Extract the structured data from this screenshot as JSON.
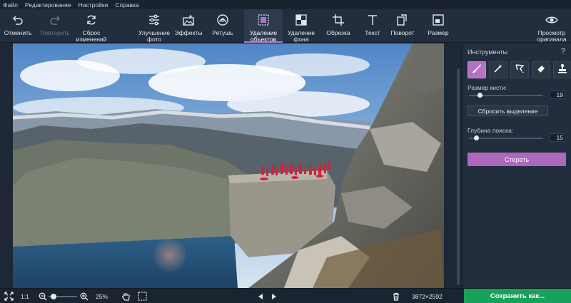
{
  "menu": [
    "Файл",
    "Редактирование",
    "Настройки",
    "Справка"
  ],
  "toolbar": {
    "undo": "Отменить",
    "redo": "Повторить",
    "reset": "Сброс\nизменений",
    "enhance": "Улучшение\nфото",
    "effects": "Эффекты",
    "retouch": "Ретушь",
    "object_removal": "Удаление\nобъектов",
    "bg_removal": "Удаление\nфона",
    "crop": "Обрезка",
    "text": "Текст",
    "rotate": "Поворот",
    "resize": "Размер",
    "preview": "Просмотр\nоригинала"
  },
  "panel": {
    "title": "Инструменты",
    "help": "?",
    "tools": [
      "brush-icon",
      "magic-wand-icon",
      "lasso-icon",
      "eraser-icon",
      "stamp-icon"
    ],
    "brush_size_label": "Размер кисти:",
    "brush_size_value": "19",
    "brush_size_fraction": 0.12,
    "reset_selection": "Сбросить выделение",
    "search_depth_label": "Глубина поиска:",
    "search_depth_value": "15",
    "search_depth_fraction": 0.07,
    "erase": "Стереть"
  },
  "bottom": {
    "ratio": "1:1",
    "zoom": "25%",
    "dimensions": "3872×2592",
    "save": "Сохранить как..."
  },
  "colors": {
    "accent": "#b472c6",
    "save": "#19a05a",
    "selection": "#d81f3a"
  }
}
